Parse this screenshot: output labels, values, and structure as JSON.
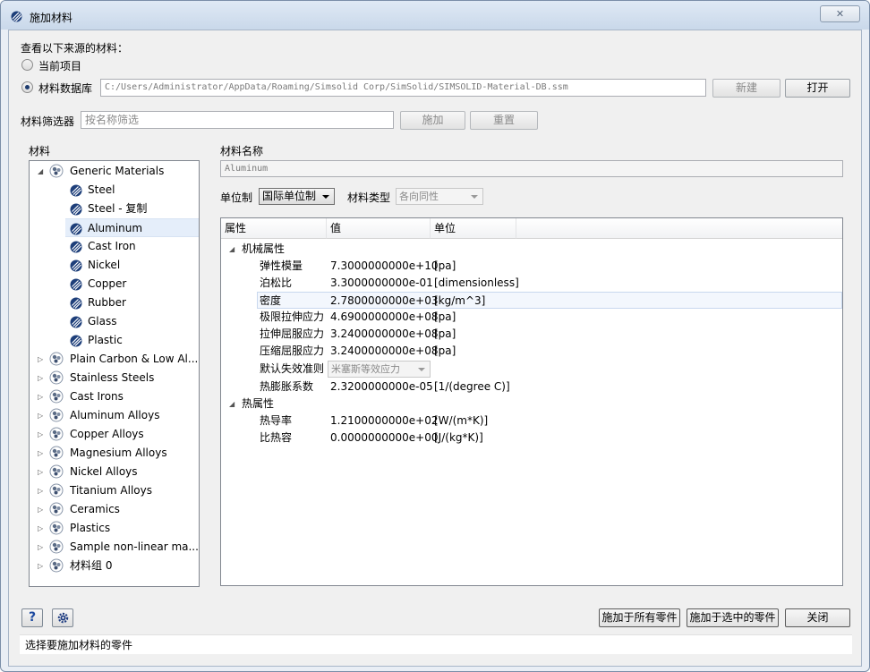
{
  "window": {
    "title": "施加材料",
    "close_glyph": "✕"
  },
  "source": {
    "heading": "查看以下来源的材料：",
    "option_current": "当前项目",
    "option_db": "材料数据库",
    "db_path": "C:/Users/Administrator/AppData/Roaming/Simsolid Corp/SimSolid/SIMSOLID-Material-DB.ssm",
    "new_label": "新建",
    "open_label": "打开"
  },
  "filter": {
    "label": "材料筛选器",
    "placeholder": "按名称筛选",
    "apply_label": "施加",
    "reset_label": "重置"
  },
  "tree": {
    "header": "材料",
    "groups": [
      {
        "label": "Generic Materials",
        "expanded": true,
        "children": [
          "Steel",
          "Steel - 复制",
          "Aluminum",
          "Cast Iron",
          "Nickel",
          "Copper",
          "Rubber",
          "Glass",
          "Plastic"
        ]
      },
      {
        "label": "Plain Carbon & Low Al..."
      },
      {
        "label": "Stainless Steels"
      },
      {
        "label": "Cast Irons"
      },
      {
        "label": "Aluminum Alloys"
      },
      {
        "label": "Copper Alloys"
      },
      {
        "label": "Magnesium Alloys"
      },
      {
        "label": "Nickel Alloys"
      },
      {
        "label": "Titanium Alloys"
      },
      {
        "label": "Ceramics"
      },
      {
        "label": "Plastics"
      },
      {
        "label": "Sample non-linear ma..."
      },
      {
        "label": "材料组 0"
      }
    ],
    "selected": "Aluminum"
  },
  "material": {
    "name_label": "材料名称",
    "name_value": "Aluminum",
    "units_label": "单位制",
    "units_value": "国际单位制",
    "type_label": "材料类型",
    "type_value": "各向同性"
  },
  "props": {
    "col_property": "属性",
    "col_value": "值",
    "col_unit": "单位",
    "mech_section": "机械属性",
    "mech_rows": [
      {
        "name": "弹性模量",
        "value": "7.3000000000e+10",
        "unit": "[pa]"
      },
      {
        "name": "泊松比",
        "value": "3.3000000000e-01",
        "unit": "[dimensionless]"
      },
      {
        "name": "密度",
        "value": "2.7800000000e+03",
        "unit": "[kg/m^3]"
      },
      {
        "name": "极限拉伸应力",
        "value": "4.6900000000e+08",
        "unit": "[pa]"
      },
      {
        "name": "拉伸屈服应力",
        "value": "3.2400000000e+08",
        "unit": "[pa]"
      },
      {
        "name": "压缩屈服应力",
        "value": "3.2400000000e+08",
        "unit": "[pa]"
      }
    ],
    "failure_name": "默认失效准则",
    "failure_value": "米塞斯等效应力",
    "expansion": {
      "name": "热膨胀系数",
      "value": "2.3200000000e-05",
      "unit": "[1/(degree C)]"
    },
    "thermal_section": "热属性",
    "thermal_rows": [
      {
        "name": "热导率",
        "value": "1.2100000000e+02",
        "unit": "[W/(m*K)]"
      },
      {
        "name": "比热容",
        "value": "0.0000000000e+00",
        "unit": "[J/(kg*K)]"
      }
    ]
  },
  "footer": {
    "help_label": "?",
    "apply_all_label": "施加于所有零件",
    "apply_selected_label": "施加于选中的零件",
    "close_label": "关闭",
    "status": "选择要施加材料的零件"
  }
}
